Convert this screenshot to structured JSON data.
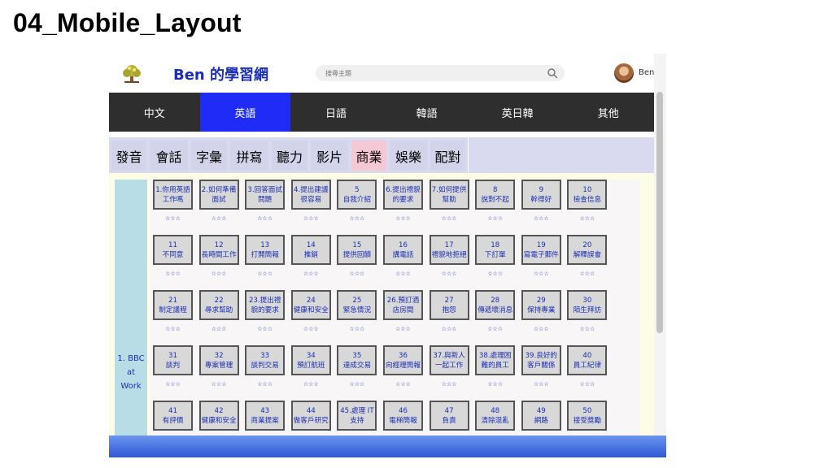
{
  "slide": {
    "title": "04_Mobile_Layout"
  },
  "header": {
    "site_title": "Ben 的學習網",
    "search_placeholder": "搜尋主題",
    "user_name": "Ben"
  },
  "top_nav": [
    {
      "label": "中文",
      "active": false
    },
    {
      "label": "英語",
      "active": true
    },
    {
      "label": "日語",
      "active": false
    },
    {
      "label": "韓語",
      "active": false
    },
    {
      "label": "英日韓",
      "active": false
    },
    {
      "label": "其他",
      "active": false
    }
  ],
  "sub_nav": [
    {
      "label": "發音",
      "active": false
    },
    {
      "label": "會話",
      "active": false
    },
    {
      "label": "字彙",
      "active": false
    },
    {
      "label": "拼寫",
      "active": false
    },
    {
      "label": "聽力",
      "active": false
    },
    {
      "label": "影片",
      "active": false
    },
    {
      "label": "商業",
      "active": true
    },
    {
      "label": "娛樂",
      "active": false
    },
    {
      "label": "配對",
      "active": false
    }
  ],
  "category": {
    "lines": [
      "1. BBC",
      "at",
      "Work"
    ]
  },
  "lessons": [
    {
      "lines": [
        "1.你用英語",
        "工作嗎"
      ],
      "rating": "☆☆☆"
    },
    {
      "lines": [
        "2.如何準備",
        "面試"
      ],
      "rating": "☆☆☆"
    },
    {
      "lines": [
        "3.回答面試",
        "問題"
      ],
      "rating": "☆☆☆"
    },
    {
      "lines": [
        "4.提出建議",
        "很容易"
      ],
      "rating": "☆☆☆"
    },
    {
      "lines": [
        "5",
        "自我介紹"
      ],
      "rating": "☆☆☆"
    },
    {
      "lines": [
        "6.提出禮貌",
        "的要求"
      ],
      "rating": "☆☆☆"
    },
    {
      "lines": [
        "7.如何提供",
        "幫助"
      ],
      "rating": "☆☆☆"
    },
    {
      "lines": [
        "8",
        "說對不起"
      ],
      "rating": "☆☆☆"
    },
    {
      "lines": [
        "9",
        "幹得好"
      ],
      "rating": "☆☆☆"
    },
    {
      "lines": [
        "10",
        "檢查信息"
      ],
      "rating": "☆☆☆"
    },
    {
      "lines": [
        "11",
        "不同意"
      ],
      "rating": "☆☆☆"
    },
    {
      "lines": [
        "12",
        "長時間工作"
      ],
      "rating": "☆☆☆"
    },
    {
      "lines": [
        "13",
        "打開簡報"
      ],
      "rating": "☆☆☆"
    },
    {
      "lines": [
        "14",
        "推銷"
      ],
      "rating": "☆☆☆"
    },
    {
      "lines": [
        "15",
        "提供回饋"
      ],
      "rating": "☆☆☆"
    },
    {
      "lines": [
        "16",
        "講電話"
      ],
      "rating": "☆☆☆"
    },
    {
      "lines": [
        "17",
        "禮貌地拒絕"
      ],
      "rating": "☆☆☆"
    },
    {
      "lines": [
        "18",
        "下訂單"
      ],
      "rating": "☆☆☆"
    },
    {
      "lines": [
        "19",
        "寫電子郵件"
      ],
      "rating": "☆☆☆"
    },
    {
      "lines": [
        "20",
        "解釋誤會"
      ],
      "rating": "☆☆☆"
    },
    {
      "lines": [
        "21",
        "制定議程"
      ],
      "rating": "☆☆☆"
    },
    {
      "lines": [
        "22",
        "尋求幫助"
      ],
      "rating": "☆☆☆"
    },
    {
      "lines": [
        "23.提出禮",
        "貌的要求"
      ],
      "rating": "☆☆☆"
    },
    {
      "lines": [
        "24",
        "健康和安全"
      ],
      "rating": "☆☆☆"
    },
    {
      "lines": [
        "25",
        "緊急情況"
      ],
      "rating": "☆☆☆"
    },
    {
      "lines": [
        "26.預訂酒",
        "店房間"
      ],
      "rating": "☆☆☆"
    },
    {
      "lines": [
        "27",
        "抱怨"
      ],
      "rating": "☆☆☆"
    },
    {
      "lines": [
        "28",
        "傳遞壞消息"
      ],
      "rating": "☆☆☆"
    },
    {
      "lines": [
        "29",
        "保持專業"
      ],
      "rating": "☆☆☆"
    },
    {
      "lines": [
        "30",
        "陌生拜訪"
      ],
      "rating": "☆☆☆"
    },
    {
      "lines": [
        "31",
        "談判"
      ],
      "rating": "☆☆☆"
    },
    {
      "lines": [
        "32",
        "專案管理"
      ],
      "rating": "☆☆☆"
    },
    {
      "lines": [
        "33",
        "談判交易"
      ],
      "rating": "☆☆☆"
    },
    {
      "lines": [
        "34",
        "預訂航班"
      ],
      "rating": "☆☆☆"
    },
    {
      "lines": [
        "35",
        "達成交易"
      ],
      "rating": "☆☆☆"
    },
    {
      "lines": [
        "36",
        "向經理簡報"
      ],
      "rating": "☆☆☆"
    },
    {
      "lines": [
        "37.與新人",
        "一起工作"
      ],
      "rating": "☆☆☆"
    },
    {
      "lines": [
        "38.處理困",
        "難的員工"
      ],
      "rating": "☆☆☆"
    },
    {
      "lines": [
        "39.良好的",
        "客戶關係"
      ],
      "rating": "☆☆☆"
    },
    {
      "lines": [
        "40",
        "員工紀律"
      ],
      "rating": "☆☆☆"
    },
    {
      "lines": [
        "41",
        "有評價"
      ],
      "rating": ""
    },
    {
      "lines": [
        "42",
        "健康和安全"
      ],
      "rating": ""
    },
    {
      "lines": [
        "43",
        "商業提案"
      ],
      "rating": ""
    },
    {
      "lines": [
        "44",
        "做客戶研究"
      ],
      "rating": ""
    },
    {
      "lines": [
        "45.處理 IT",
        "支持"
      ],
      "rating": ""
    },
    {
      "lines": [
        "46",
        "電梯簡報"
      ],
      "rating": ""
    },
    {
      "lines": [
        "47",
        "負責"
      ],
      "rating": ""
    },
    {
      "lines": [
        "48",
        "清除混亂"
      ],
      "rating": ""
    },
    {
      "lines": [
        "49",
        "網路"
      ],
      "rating": ""
    },
    {
      "lines": [
        "50",
        "接受獎勵"
      ],
      "rating": ""
    }
  ],
  "colors": {
    "nav_active": "#1f2cf5",
    "nav_bg": "#2e2e2e",
    "link_blue": "#1a2fb5",
    "sub_active": "#f4c8d4",
    "content_bg": "#fdfde5",
    "category_bg": "#b8dde6"
  }
}
